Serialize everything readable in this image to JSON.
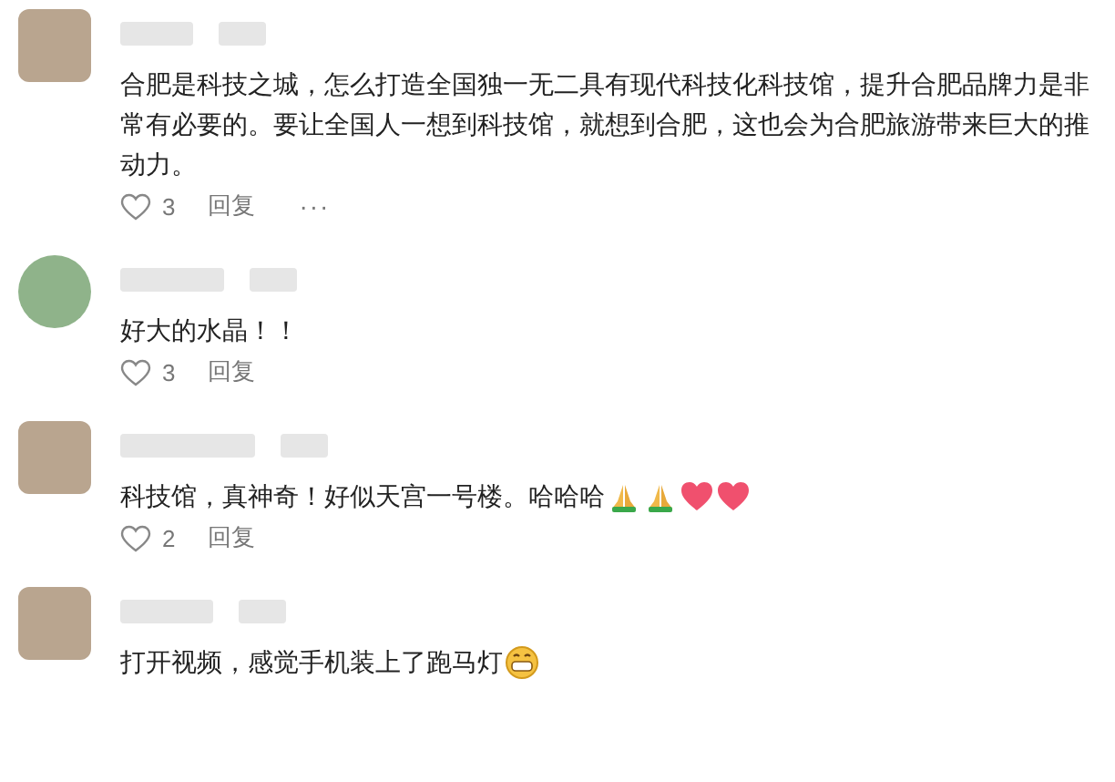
{
  "comments": [
    {
      "kind": "square",
      "text": "合肥是科技之城，怎么打造全国独一无二具有现代科技化科技馆，提升合肥品牌力是非常有必要的。要让全国人一想到科技馆，就想到合肥，这也会为合肥旅游带来巨大的推动力。",
      "likes": "3",
      "reply": "回复",
      "more": "···"
    },
    {
      "kind": "circle",
      "text": "好大的水晶！！",
      "likes": "3",
      "reply": "回复"
    },
    {
      "kind": "square",
      "text": "科技馆，真神奇！好似天宫一号楼。哈哈哈",
      "emoji": [
        {
          "kind": "pray"
        },
        {
          "kind": "pray"
        },
        {
          "kind": "heart"
        },
        {
          "kind": "heart"
        }
      ],
      "likes": "2",
      "reply": "回复"
    },
    {
      "kind": "square",
      "text": "打开视频，感觉手机装上了跑马灯",
      "emoji": [
        {
          "kind": "grin"
        }
      ]
    }
  ]
}
